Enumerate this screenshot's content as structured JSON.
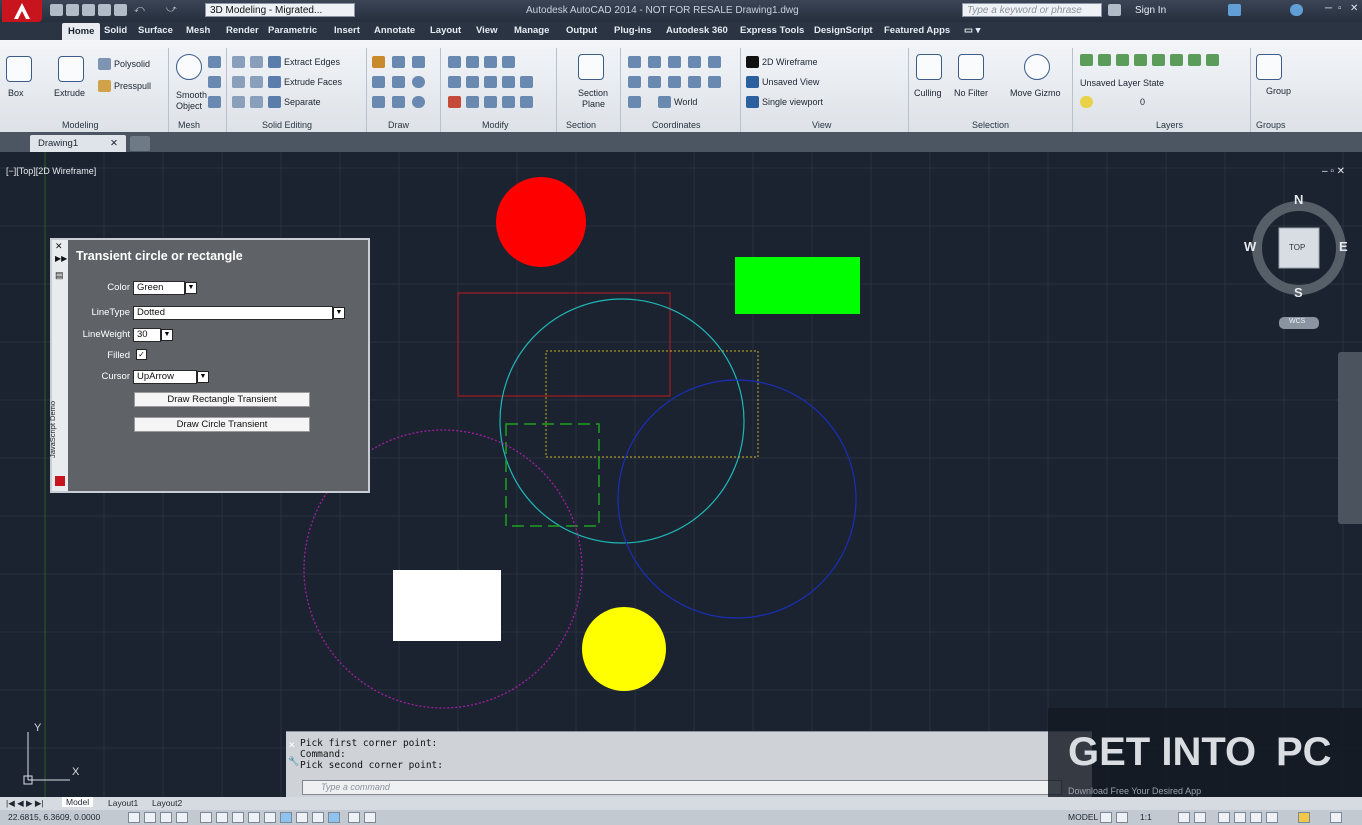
{
  "title_bar": {
    "workspace": "3D Modeling - Migrated...",
    "app_title": "Autodesk AutoCAD 2014 - NOT FOR RESALE   Drawing1.dwg",
    "search_placeholder": "Type a keyword or phrase",
    "sign_in": "Sign In"
  },
  "ribbon_tabs": [
    "Home",
    "Solid",
    "Surface",
    "Mesh",
    "Render",
    "Parametric",
    "Insert",
    "Annotate",
    "Layout",
    "View",
    "Manage",
    "Output",
    "Plug-ins",
    "Autodesk 360",
    "Express Tools",
    "DesignScript",
    "Featured Apps"
  ],
  "ribbon": {
    "box": "Box",
    "extrude": "Extrude",
    "polysolid": "Polysolid",
    "presspull": "Presspull",
    "smooth_object_1": "Smooth",
    "smooth_object_2": "Object",
    "extract_edges": "Extract Edges",
    "extrude_faces": "Extrude Faces",
    "separate": "Separate",
    "section_plane_1": "Section",
    "section_plane_2": "Plane",
    "world": "World",
    "visual_style": "2D Wireframe",
    "saved_view": "Unsaved View",
    "viewport_config": "Single viewport",
    "culling": "Culling",
    "no_filter": "No Filter",
    "move_gizmo": "Move Gizmo",
    "layer_state": "Unsaved Layer State",
    "layer_current": "0",
    "group": "Group",
    "panels": {
      "modeling": "Modeling",
      "mesh": "Mesh",
      "solid_editing": "Solid Editing",
      "draw": "Draw",
      "modify": "Modify",
      "section": "Section",
      "coordinates": "Coordinates",
      "view": "View",
      "selection": "Selection",
      "layers": "Layers",
      "groups": "Groups"
    }
  },
  "doc_tab": "Drawing1",
  "viewport": {
    "label": "[−][Top][2D Wireframe]",
    "compass": {
      "n": "N",
      "s": "S",
      "e": "E",
      "w": "W",
      "cube": "TOP",
      "wcs": "WCS"
    },
    "ucs_y": "Y",
    "ucs_x": "X"
  },
  "palette": {
    "title": "Transient circle or rectangle",
    "side_label": "JavaScript Demo",
    "color_label": "Color",
    "color_value": "Green",
    "linetype_label": "LineType",
    "linetype_value": "Dotted",
    "lineweight_label": "LineWeight",
    "lineweight_value": "30",
    "filled_label": "Filled",
    "filled": true,
    "cursor_label": "Cursor",
    "cursor_value": "UpArrow",
    "btn_rect": "Draw Rectangle Transient",
    "btn_circle": "Draw Circle Transient"
  },
  "command": {
    "line1": "Pick first corner point:",
    "line2": "Command:",
    "line3": "Pick second corner point:",
    "placeholder": "Type a command"
  },
  "layout_tabs": [
    "Model",
    "Layout1",
    "Layout2"
  ],
  "status": {
    "coords": "22.6815, 6.3609, 0.0000",
    "model": "MODEL",
    "scale": "1:1"
  },
  "watermark": {
    "get_into": "GET INTO",
    "pc": "PC",
    "subtitle": "Download Free Your Desired App"
  },
  "colors": {
    "red": "#ff0000",
    "green": "#00ff00",
    "yellow": "#ffff00",
    "white": "#ffffff",
    "cyan": "#1fb7b7",
    "blue": "#1a2fb8",
    "magenta": "#a11fa1"
  }
}
